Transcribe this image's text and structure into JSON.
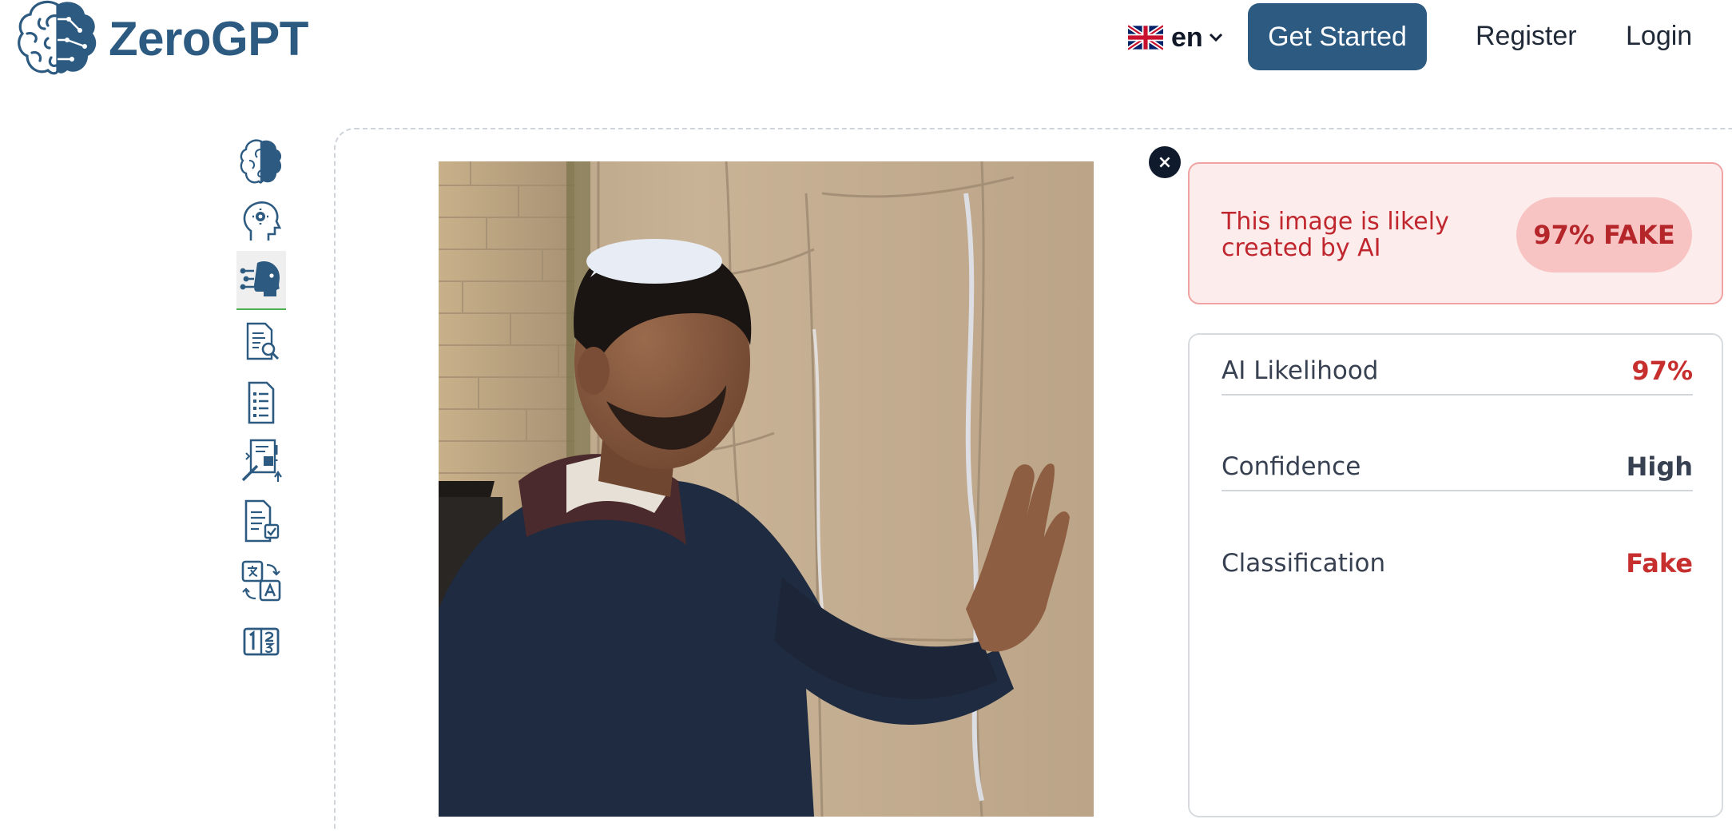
{
  "header": {
    "logo_text": "ZeroGPT",
    "language_code": "en",
    "get_started_label": "Get Started",
    "register_label": "Register",
    "login_label": "Login"
  },
  "sidebar": {
    "items": [
      {
        "icon": "brain-icon",
        "active": false
      },
      {
        "icon": "ai-head-icon",
        "active": false
      },
      {
        "icon": "ai-face-detector-icon",
        "active": true
      },
      {
        "icon": "document-search-icon",
        "active": false
      },
      {
        "icon": "document-list-icon",
        "active": false
      },
      {
        "icon": "document-tools-icon",
        "active": false
      },
      {
        "icon": "document-check-icon",
        "active": false
      },
      {
        "icon": "translate-icon",
        "active": false
      },
      {
        "icon": "word-counter-icon",
        "active": false
      }
    ]
  },
  "result": {
    "remove_label": "×",
    "verdict_text": "This image is likely created by AI",
    "verdict_badge": "97% FAKE",
    "stats": [
      {
        "label": "AI Likelihood",
        "value": "97%",
        "color": "#c72e2e"
      },
      {
        "label": "Confidence",
        "value": "High",
        "color": "#374151"
      },
      {
        "label": "Classification",
        "value": "Fake",
        "color": "#c72e2e"
      }
    ]
  },
  "colors": {
    "brand": "#2d5a80",
    "fake_red": "#c72e2e",
    "verdict_bg": "#fdecec",
    "badge_bg": "#f8c3c3",
    "active_underline": "#4caf50"
  }
}
